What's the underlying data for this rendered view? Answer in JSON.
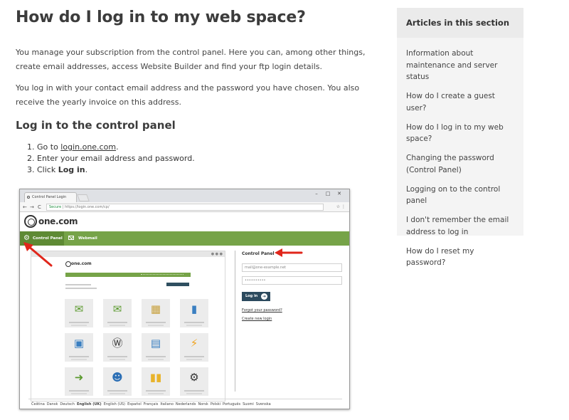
{
  "article": {
    "title": "How do I log in to my web space?",
    "para1": "You manage your subscription from the control panel. Here you can, among other things, create email addresses, access Website Builder and find your ftp login details.",
    "para2": "You log in with your contact email address and the password you have chosen. You also receive the yearly invoice on this address.",
    "subtitle": "Log in to the control panel",
    "steps": [
      {
        "num": "1.",
        "before": "Go to ",
        "link": "login.one.com",
        "after": "."
      },
      {
        "num": "2.",
        "text": "Enter your email address and password."
      },
      {
        "num": "3.",
        "before": "Click ",
        "bold": "Log in",
        "after": "."
      }
    ]
  },
  "screenshot": {
    "browser": {
      "tab_title": "Control Panel Login",
      "nav_back": "←",
      "nav_forward": "→",
      "nav_reload": "C",
      "secure_label": "Secure",
      "url": "https://login.one.com/cp/",
      "addr_icons": "☆ ⋮",
      "win_minimize": "–",
      "win_maximize": "□",
      "win_close": "✕"
    },
    "logo_text": "one.com",
    "mini_logo_text": "one.com",
    "mini_dots": "● ● ●",
    "nav": {
      "gear": "⚙",
      "control_panel": "Control Panel",
      "webmail": "Webmail"
    },
    "login": {
      "title": "Control Panel",
      "email_value": "mail@one-example.net",
      "password_value": "••••••••••",
      "login_button": "Log in",
      "login_icon": "➔",
      "forgot_link": "Forgot your password?",
      "create_link": "Create new login"
    },
    "tiles": [
      {
        "icon": "email-icon",
        "glyph": "✉",
        "color": "#5b9a2f"
      },
      {
        "icon": "email-settings-icon",
        "glyph": "✉",
        "color": "#5b9a2f"
      },
      {
        "icon": "website-builder-icon",
        "glyph": "▦",
        "color": "#c7a03c"
      },
      {
        "icon": "file-manager-icon",
        "glyph": "▮",
        "color": "#3a7fc1"
      },
      {
        "icon": "photo-gallery-icon",
        "glyph": "▣",
        "color": "#3a7fc1"
      },
      {
        "icon": "wordpress-icon",
        "glyph": "Ⓦ",
        "color": "#333333"
      },
      {
        "icon": "calculator-icon",
        "glyph": "▤",
        "color": "#3a7fc1"
      },
      {
        "icon": "lightning-icon",
        "glyph": "⚡",
        "color": "#f0a31d"
      },
      {
        "icon": "chat-icon",
        "glyph": "➜",
        "color": "#5b9a2f"
      },
      {
        "icon": "user-icon",
        "glyph": "☻",
        "color": "#2c6fb5"
      },
      {
        "icon": "stats-icon",
        "glyph": "▮▮",
        "color": "#e8b32b"
      },
      {
        "icon": "settings-icon",
        "glyph": "⚙",
        "color": "#333333"
      }
    ],
    "languages": [
      "Čeština",
      "Dansk",
      "Deutsch",
      "English (UK)",
      "English (US)",
      "Español",
      "Français",
      "Italiano",
      "Nederlands",
      "Norsk",
      "Polski",
      "Português",
      "Suomi",
      "Svenska"
    ],
    "selected_language": "English (UK)",
    "arrow_color": "#e0261b"
  },
  "sidebar": {
    "heading": "Articles in this section",
    "items": [
      "Information about maintenance and server status",
      "How do I create a guest user?",
      "How do I log in to my web space?",
      "Changing the password (Control Panel)",
      "Logging on to the control panel",
      "I don't remember the email address to log in",
      "How do I reset my password?"
    ]
  }
}
